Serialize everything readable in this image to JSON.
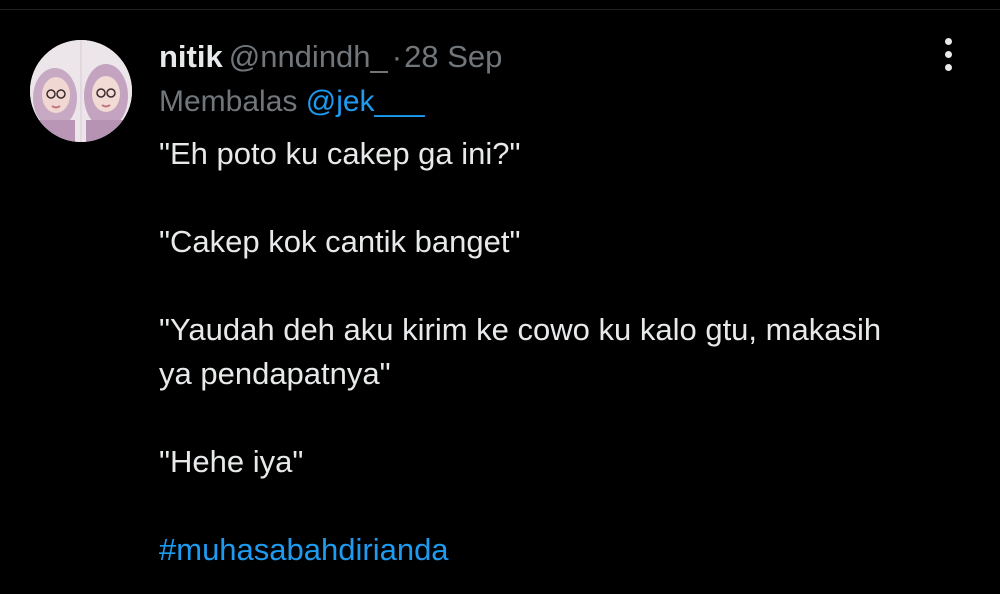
{
  "tweet": {
    "author": {
      "display_name": "nitik",
      "handle": "@nndindh_",
      "avatar": "profile-photo"
    },
    "separator": "·",
    "timestamp": "28 Sep",
    "reply": {
      "prefix": "Membalas",
      "mention": "@jek___"
    },
    "body": {
      "line1": "\"Eh poto ku cakep ga ini?\"",
      "line2": "\"Cakep kok cantik banget\"",
      "line3a": "\"Yaudah deh aku kirim ke cowo ku kalo gtu, makasih",
      "line3b": "ya pendapatnya\"",
      "line4": "\"Hehe iya\"",
      "hashtag": "#muhasabahdirianda"
    },
    "more_icon": "more-vertical-icon"
  },
  "colors": {
    "background": "#000000",
    "text_primary": "#e7e9ea",
    "text_secondary": "#71767b",
    "link": "#1d9bf0"
  }
}
